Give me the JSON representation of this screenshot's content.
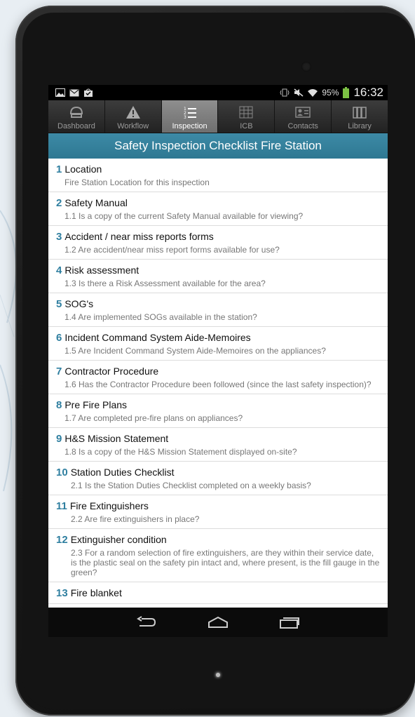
{
  "statusbar": {
    "time": "16:32",
    "battery": "95%",
    "icons_left": [
      "image-icon",
      "mail-icon",
      "bag-icon"
    ],
    "icons_right": [
      "vibrate-icon",
      "mute-icon",
      "wifi-icon",
      "battery-icon"
    ]
  },
  "tabs": [
    {
      "label": "Dashboard",
      "icon": "dashboard-icon",
      "active": false
    },
    {
      "label": "Workflow",
      "icon": "warning-icon",
      "active": false
    },
    {
      "label": "Inspection",
      "icon": "list-icon",
      "active": true
    },
    {
      "label": "ICB",
      "icon": "grid-icon",
      "active": false
    },
    {
      "label": "Contacts",
      "icon": "contact-card-icon",
      "active": false
    },
    {
      "label": "Library",
      "icon": "books-icon",
      "active": false
    }
  ],
  "header": {
    "title": "Safety Inspection Checklist Fire Station"
  },
  "items": [
    {
      "num": "1",
      "title": "Location",
      "sub": "Fire Station Location for this inspection"
    },
    {
      "num": "2",
      "title": "Safety Manual",
      "sub": "1.1 Is a copy of the current Safety Manual available for viewing?"
    },
    {
      "num": "3",
      "title": "Accident / near miss reports forms",
      "sub": "1.2 Are accident/near miss report forms available for use?"
    },
    {
      "num": "4",
      "title": "Risk assessment",
      "sub": "1.3 Is there a Risk Assessment available for the area?"
    },
    {
      "num": "5",
      "title": "SOG's",
      "sub": "1.4 Are implemented SOGs available in the station?"
    },
    {
      "num": "6",
      "title": "Incident Command System Aide-Memoires",
      "sub": "1.5 Are Incident Command System Aide-Memoires on the appliances?"
    },
    {
      "num": "7",
      "title": "Contractor Procedure",
      "sub": "1.6 Has the Contractor Procedure been followed (since the last safety inspection)?"
    },
    {
      "num": "8",
      "title": "Pre Fire Plans",
      "sub": "1.7 Are completed pre-fire plans on appliances?"
    },
    {
      "num": "9",
      "title": "H&S Mission Statement",
      "sub": "1.8 Is a copy of the H&S Mission Statement displayed on-site?"
    },
    {
      "num": "10",
      "title": "Station Duties Checklist",
      "sub": "2.1 Is the Station Duties Checklist completed on a weekly basis?"
    },
    {
      "num": "11",
      "title": "Fire Extinguishers",
      "sub": "2.2 Are fire extinguishers in place?"
    },
    {
      "num": "12",
      "title": "Extinguisher condition",
      "sub": "2.3 For a random selection of fire extinguishers, are they within their service date, is the plastic seal on the safety pin intact and, where present, is the fill gauge in the green?"
    },
    {
      "num": "13",
      "title": "Fire blanket",
      "sub": ""
    }
  ],
  "navbar": {
    "buttons": [
      "back-icon",
      "home-icon",
      "recent-apps-icon"
    ]
  },
  "colors": {
    "accent": "#2f7fa0",
    "titlebar": "#3385a0",
    "tab_active": "#808080"
  }
}
